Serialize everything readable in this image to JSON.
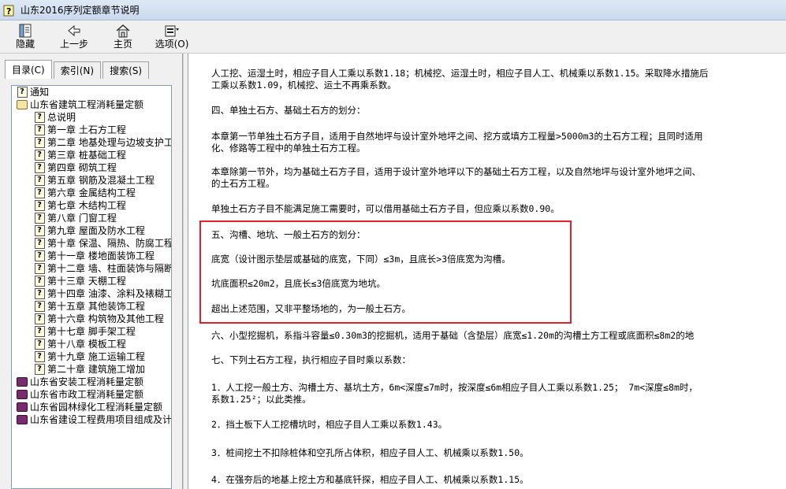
{
  "window": {
    "title": "山东2016序列定额章节说明"
  },
  "toolbar": {
    "hide": "隐藏",
    "back": "上一步",
    "home": "主页",
    "options": "选项(O)"
  },
  "tabs": {
    "contents": "目录(C)",
    "index": "索引(N)",
    "search": "搜索(S)"
  },
  "tree": [
    {
      "label": "通知",
      "icon": "question",
      "level": 0
    },
    {
      "label": "山东省建筑工程消耗量定额",
      "icon": "open-book",
      "level": 0
    },
    {
      "label": "总说明",
      "icon": "question",
      "level": 1
    },
    {
      "label": "第一章  土石方工程",
      "icon": "question",
      "level": 1
    },
    {
      "label": "第二章  地基处理与边坡支护工程",
      "icon": "question",
      "level": 1
    },
    {
      "label": "第三章  桩基础工程",
      "icon": "question",
      "level": 1
    },
    {
      "label": "第四章  砌筑工程",
      "icon": "question",
      "level": 1
    },
    {
      "label": "第五章  钢筋及混凝土工程",
      "icon": "question",
      "level": 1
    },
    {
      "label": "第六章  金属结构工程",
      "icon": "question",
      "level": 1
    },
    {
      "label": "第七章  木结构工程",
      "icon": "question",
      "level": 1
    },
    {
      "label": "第八章  门窗工程",
      "icon": "question",
      "level": 1
    },
    {
      "label": "第九章  屋面及防水工程",
      "icon": "question",
      "level": 1
    },
    {
      "label": "第十章  保温、隔热、防腐工程",
      "icon": "question",
      "level": 1
    },
    {
      "label": "第十一章  楼地面装饰工程",
      "icon": "question",
      "level": 1
    },
    {
      "label": "第十二章  墙、柱面装饰与隔断工程",
      "icon": "question",
      "level": 1
    },
    {
      "label": "第十三章  天棚工程",
      "icon": "question",
      "level": 1
    },
    {
      "label": "第十四章  油漆、涂料及裱糊工程",
      "icon": "question",
      "level": 1
    },
    {
      "label": "第十五章  其他装饰工程",
      "icon": "question",
      "level": 1
    },
    {
      "label": "第十六章  构筑物及其他工程",
      "icon": "question",
      "level": 1
    },
    {
      "label": "第十七章  脚手架工程",
      "icon": "question",
      "level": 1
    },
    {
      "label": "第十八章  模板工程",
      "icon": "question",
      "level": 1
    },
    {
      "label": "第十九章  施工运输工程",
      "icon": "question",
      "level": 1
    },
    {
      "label": "第二十章  建筑施工增加",
      "icon": "question",
      "level": 1
    },
    {
      "label": "山东省安装工程消耗量定额",
      "icon": "closed-book",
      "level": 0
    },
    {
      "label": "山东省市政工程消耗量定额",
      "icon": "closed-book",
      "level": 0
    },
    {
      "label": "山东省园林绿化工程消耗量定额",
      "icon": "closed-book",
      "level": 0
    },
    {
      "label": "山东省建设工程费用项目组成及计算规则",
      "icon": "closed-book",
      "level": 0
    }
  ],
  "content": {
    "p1_l1": "人工挖、运湿土时，相应子目人工乘以系数1.18；机械挖、运湿土时，相应子目人工、机械乘以系数1.15。采取降水措施后",
    "p1_l2": "工乘以系数1.09，机械挖、运土不再乘系数。",
    "p2": "四、单独土石方、基础土石方的划分：",
    "p3_l1": "本章第一节单独土石方子目，适用于自然地坪与设计室外地坪之间、挖方或填方工程量>5000m3的土石方工程；且同时适用",
    "p3_l2": "化、修路等工程中的单独土石方工程。",
    "p4_l1": "本章除第一节外，均为基础土石方子目，适用于设计室外地坪以下的基础土石方工程，以及自然地坪与设计室外地坪之间、",
    "p4_l2": "的土石方工程。",
    "p5": "单独土石方子目不能满足施工需要时，可以借用基础土石方子目，但应乘以系数0.90。",
    "p6": "五、沟槽、地坑、一般土石方的划分：",
    "p7": "底宽（设计图示垫层或基础的底宽，下同）≤3m，且底长>3倍底宽为沟槽。",
    "p8": "坑底面积≤20m2，且底长≤3倍底宽为地坑。",
    "p9": "超出上述范围，又非平整场地的，为一般土石方。",
    "p10": "六、小型挖掘机，系指斗容量≤0.30m3的挖掘机，适用于基础（含垫层）底宽≤1.20m的沟槽土方工程或底面积≤8m2的地",
    "p11": "七、下列土石方工程，执行相应子目时乘以系数：",
    "p12_l1": "1．人工挖一般土方、沟槽土方、基坑土方，6m<深度≤7m时，按深度≤6m相应子目人工乘以系数1.25； 7m<深度≤8m时，",
    "p12_l2": "系数1.25²；以此类推。",
    "p13": "2．挡土板下人工挖槽坑时，相应子目人工乘以系数1.43。",
    "p14": "3．桩间挖土不扣除桩体和空孔所占体积，相应子目人工、机械乘以系数1.50。",
    "p15": "4．在强夯后的地基上挖土方和基底钎探，相应子目人工、机械乘以系数1.15。"
  },
  "colors": {
    "highlight_border": "#e0202a",
    "title_bar": "#c9d9ee"
  }
}
